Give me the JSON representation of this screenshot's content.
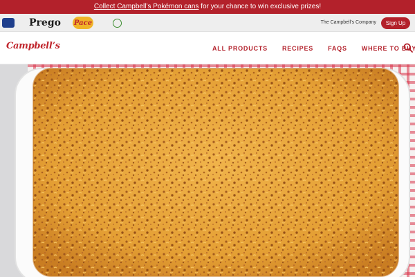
{
  "promo": {
    "link_text": "Collect Campbell’s Pokémon cans",
    "rest_text": " for your chance to win exclusive prizes!"
  },
  "brands": {
    "swanson": "SWANSON",
    "prego": "Prego",
    "pace": "Pace",
    "v8": "V8",
    "company_link": "The Campbell’s Company",
    "signup": "Sign Up"
  },
  "nav": {
    "logo": "Campbell’s",
    "links": [
      "ALL PRODUCTS",
      "RECIPES",
      "FAQS",
      "WHERE TO BUY"
    ],
    "search_icon": "search-icon"
  },
  "hero": {
    "alt": "mac-and-cheese-casserole-photo"
  },
  "colors": {
    "brand_red": "#b3212b",
    "strip_gray": "#eeeeee",
    "cheese": "#e9a93a",
    "crumb": "#a85a1e"
  }
}
